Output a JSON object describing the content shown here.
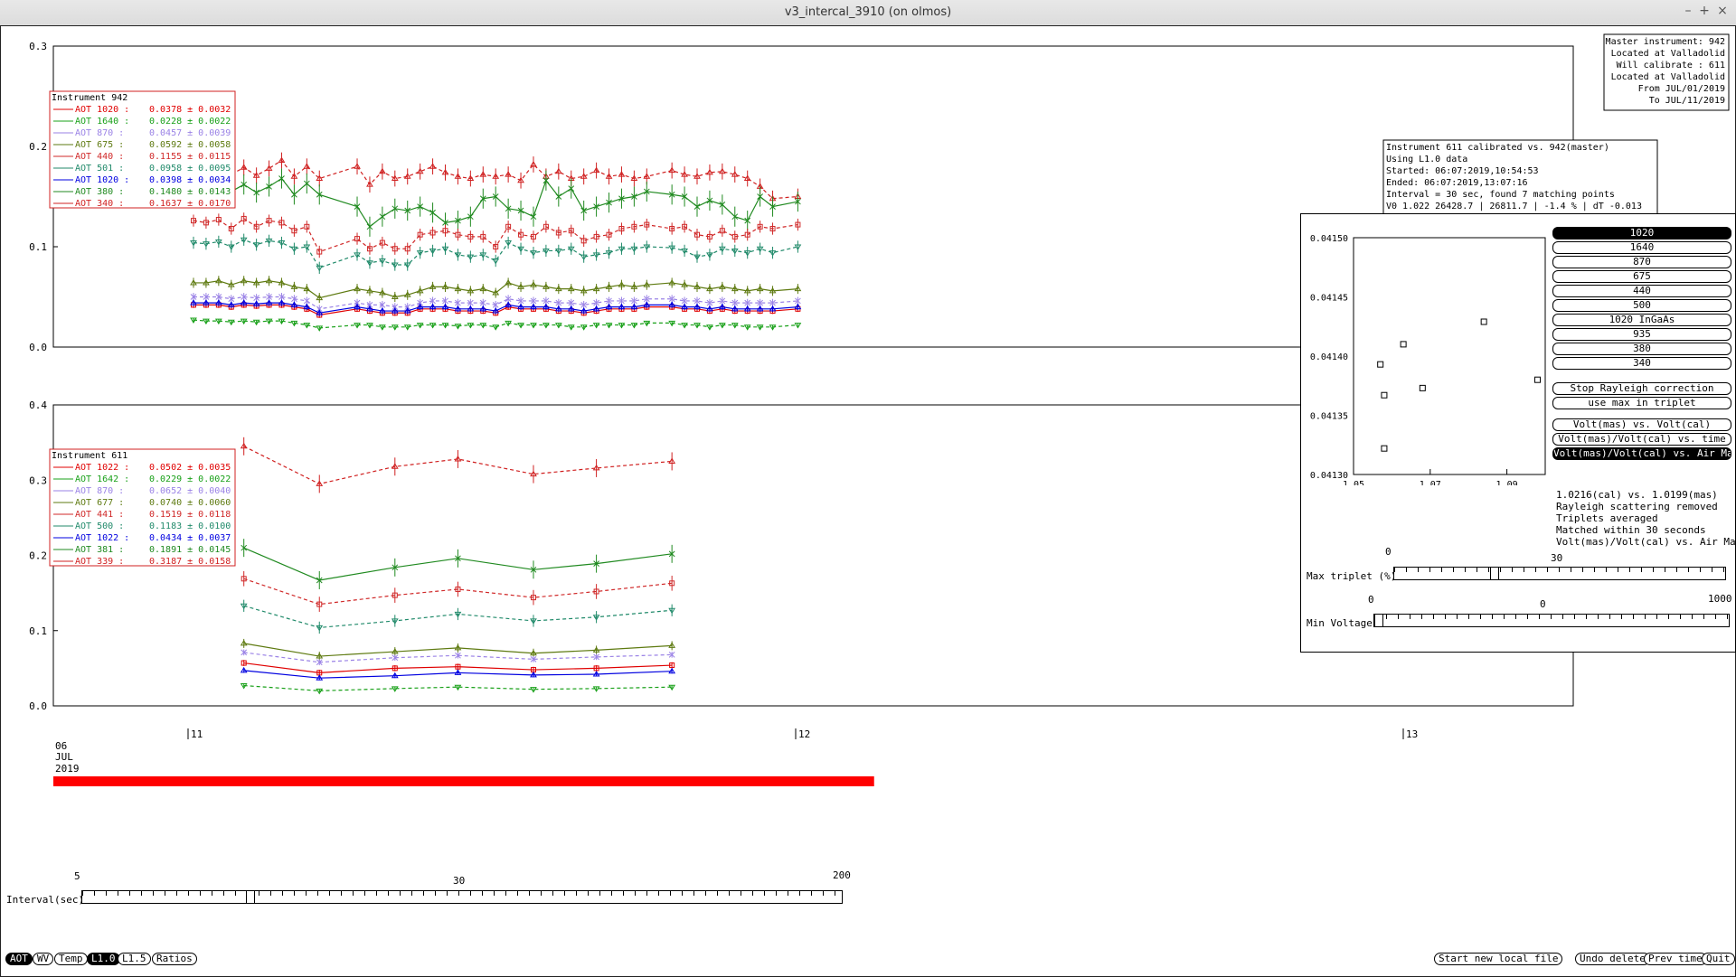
{
  "window": {
    "title": "v3_intercal_3910 (on olmos)"
  },
  "master_info": {
    "lines": [
      "Master instrument: 942",
      "Located at Valladolid",
      "Will calibrate   : 611",
      "Located at Valladolid",
      "From JUL/01/2019",
      "To JUL/11/2019"
    ]
  },
  "cal_info": {
    "lines": [
      "Instrument 611 calibrated vs. 942(master)",
      "Using L1.0 data",
      "Started: 06:07:2019,10:54:53",
      "Ended: 06:07:2019,13:07:16",
      "Interval = 30 sec, found 7 matching points",
      "V0 1.022  26428.7 | 26811.7 | -1.4 % | dT -0.013"
    ]
  },
  "upper_legend": {
    "title": "Instrument 942",
    "items": [
      {
        "label": "AOT 1020 :",
        "value": "0.0378 ± 0.0032",
        "color": "#e00000"
      },
      {
        "label": "AOT 1640 :",
        "value": "0.0228 ± 0.0022",
        "color": "#18a018"
      },
      {
        "label": "AOT 870  :",
        "value": "0.0457 ± 0.0039",
        "color": "#9a82e6"
      },
      {
        "label": "AOT 675  :",
        "value": "0.0592 ± 0.0058",
        "color": "#5e7a10"
      },
      {
        "label": "AOT 440  :",
        "value": "0.1155 ± 0.0115",
        "color": "#d02828"
      },
      {
        "label": "AOT 501  :",
        "value": "0.0958 ± 0.0095",
        "color": "#208a6a"
      },
      {
        "label": "AOT 1020 :",
        "value": "0.0398 ± 0.0034",
        "color": "#0000e0"
      },
      {
        "label": "AOT 380  :",
        "value": "0.1480 ± 0.0143",
        "color": "#208a20"
      },
      {
        "label": "AOT 340  :",
        "value": "0.1637 ± 0.0170",
        "color": "#d02020"
      }
    ]
  },
  "lower_legend": {
    "title": "Instrument 611",
    "items": [
      {
        "label": "AOT 1022 :",
        "value": "0.0502 ± 0.0035",
        "color": "#e00000"
      },
      {
        "label": "AOT 1642 :",
        "value": "0.0229 ± 0.0022",
        "color": "#18a018"
      },
      {
        "label": "AOT 870  :",
        "value": "0.0652 ± 0.0040",
        "color": "#9a82e6"
      },
      {
        "label": "AOT 677  :",
        "value": "0.0740 ± 0.0060",
        "color": "#5e7a10"
      },
      {
        "label": "AOT 441  :",
        "value": "0.1519 ± 0.0118",
        "color": "#d02828"
      },
      {
        "label": "AOT 500  :",
        "value": "0.1183 ± 0.0100",
        "color": "#208a6a"
      },
      {
        "label": "AOT 1022 :",
        "value": "0.0434 ± 0.0037",
        "color": "#0000e0"
      },
      {
        "label": "AOT 381  :",
        "value": "0.1891 ± 0.0145",
        "color": "#208a20"
      },
      {
        "label": "AOT 339  :",
        "value": "0.3187 ± 0.0158",
        "color": "#d02020"
      }
    ]
  },
  "date_label": {
    "line1": "06",
    "line2": "JUL",
    "line3": "2019"
  },
  "chart_data": [
    {
      "type": "line",
      "name": "upper",
      "ylim": [
        0,
        0.3
      ],
      "yticks": [
        "0.0",
        "0.1",
        "0.2",
        "0.3"
      ],
      "x": [
        1,
        1.5,
        2,
        2.5,
        3,
        3.5,
        4,
        4.5,
        5,
        5.5,
        6,
        7.5,
        8,
        8.5,
        9,
        9.5,
        10,
        10.5,
        11,
        11.5,
        12,
        12.5,
        13,
        13.5,
        14,
        14.5,
        15,
        15.5,
        16,
        16.5,
        17,
        17.5,
        18,
        18.5,
        19,
        20,
        20.5,
        21,
        21.5,
        22,
        22.5,
        23,
        23.5,
        24,
        25
      ],
      "series": [
        {
          "color": "#d02020",
          "dash": true,
          "marker": "triangle",
          "values": [
            0.184,
            0.182,
            0.185,
            0.172,
            0.179,
            0.171,
            0.178,
            0.186,
            0.17,
            0.18,
            0.168,
            0.18,
            0.162,
            0.175,
            0.168,
            0.17,
            0.175,
            0.18,
            0.174,
            0.17,
            0.168,
            0.172,
            0.17,
            0.172,
            0.166,
            0.182,
            0.17,
            0.175,
            0.168,
            0.17,
            0.176,
            0.17,
            0.172,
            0.168,
            0.17,
            0.176,
            0.172,
            0.17,
            0.174,
            0.175,
            0.172,
            0.168,
            0.16,
            0.148,
            0.15
          ],
          "err": 0.008
        },
        {
          "color": "#208a20",
          "dash": false,
          "marker": "x",
          "values": [
            0.166,
            0.162,
            0.168,
            0.155,
            0.162,
            0.154,
            0.16,
            0.168,
            0.152,
            0.163,
            0.152,
            0.14,
            0.12,
            0.13,
            0.138,
            0.136,
            0.14,
            0.134,
            0.124,
            0.126,
            0.13,
            0.148,
            0.15,
            0.138,
            0.136,
            0.13,
            0.166,
            0.15,
            0.158,
            0.136,
            0.14,
            0.144,
            0.148,
            0.15,
            0.155,
            0.152,
            0.15,
            0.14,
            0.146,
            0.142,
            0.13,
            0.126,
            0.15,
            0.14,
            0.145
          ],
          "err": 0.01
        },
        {
          "color": "#d02828",
          "dash": true,
          "marker": "square",
          "values": [
            0.126,
            0.124,
            0.127,
            0.118,
            0.128,
            0.12,
            0.126,
            0.124,
            0.116,
            0.12,
            0.095,
            0.108,
            0.098,
            0.104,
            0.098,
            0.098,
            0.112,
            0.114,
            0.116,
            0.112,
            0.11,
            0.11,
            0.1,
            0.12,
            0.112,
            0.11,
            0.12,
            0.114,
            0.116,
            0.106,
            0.11,
            0.112,
            0.118,
            0.12,
            0.122,
            0.118,
            0.12,
            0.112,
            0.11,
            0.116,
            0.11,
            0.112,
            0.12,
            0.118,
            0.122
          ],
          "err": 0.006
        },
        {
          "color": "#208a6a",
          "dash": true,
          "marker": "down",
          "values": [
            0.104,
            0.103,
            0.105,
            0.1,
            0.107,
            0.102,
            0.106,
            0.104,
            0.098,
            0.1,
            0.079,
            0.092,
            0.084,
            0.086,
            0.082,
            0.082,
            0.094,
            0.096,
            0.098,
            0.092,
            0.09,
            0.092,
            0.086,
            0.104,
            0.098,
            0.094,
            0.096,
            0.096,
            0.098,
            0.09,
            0.092,
            0.094,
            0.098,
            0.098,
            0.1,
            0.099,
            0.096,
            0.09,
            0.092,
            0.098,
            0.096,
            0.094,
            0.098,
            0.094,
            0.1
          ],
          "err": 0.006
        },
        {
          "color": "#5e7a10",
          "dash": false,
          "marker": "triangle",
          "values": [
            0.064,
            0.064,
            0.066,
            0.062,
            0.066,
            0.064,
            0.066,
            0.064,
            0.06,
            0.058,
            0.049,
            0.058,
            0.056,
            0.054,
            0.05,
            0.052,
            0.056,
            0.06,
            0.06,
            0.058,
            0.056,
            0.058,
            0.054,
            0.064,
            0.06,
            0.062,
            0.06,
            0.058,
            0.058,
            0.056,
            0.058,
            0.06,
            0.062,
            0.06,
            0.062,
            0.064,
            0.062,
            0.06,
            0.058,
            0.06,
            0.058,
            0.056,
            0.058,
            0.056,
            0.058
          ],
          "err": 0.005
        },
        {
          "color": "#9a82e6",
          "dash": true,
          "marker": "x",
          "values": [
            0.05,
            0.05,
            0.05,
            0.048,
            0.05,
            0.049,
            0.05,
            0.05,
            0.048,
            0.046,
            0.038,
            0.044,
            0.042,
            0.042,
            0.04,
            0.04,
            0.044,
            0.046,
            0.046,
            0.044,
            0.044,
            0.044,
            0.042,
            0.048,
            0.046,
            0.046,
            0.046,
            0.044,
            0.044,
            0.042,
            0.044,
            0.046,
            0.046,
            0.046,
            0.048,
            0.048,
            0.046,
            0.046,
            0.044,
            0.046,
            0.044,
            0.044,
            0.044,
            0.044,
            0.046
          ],
          "err": 0.004
        },
        {
          "color": "#e00000",
          "dash": false,
          "marker": "square",
          "values": [
            0.042,
            0.042,
            0.042,
            0.04,
            0.042,
            0.041,
            0.042,
            0.042,
            0.04,
            0.038,
            0.032,
            0.038,
            0.036,
            0.034,
            0.034,
            0.034,
            0.038,
            0.038,
            0.038,
            0.036,
            0.036,
            0.036,
            0.034,
            0.04,
            0.038,
            0.038,
            0.038,
            0.036,
            0.036,
            0.034,
            0.036,
            0.038,
            0.038,
            0.038,
            0.04,
            0.04,
            0.038,
            0.038,
            0.036,
            0.038,
            0.036,
            0.036,
            0.036,
            0.036,
            0.038
          ],
          "err": 0.003
        },
        {
          "color": "#0000e0",
          "dash": false,
          "marker": "triangle",
          "values": [
            0.044,
            0.044,
            0.044,
            0.042,
            0.044,
            0.043,
            0.044,
            0.044,
            0.042,
            0.04,
            0.034,
            0.04,
            0.038,
            0.036,
            0.036,
            0.036,
            0.04,
            0.04,
            0.04,
            0.038,
            0.038,
            0.038,
            0.036,
            0.042,
            0.04,
            0.04,
            0.04,
            0.038,
            0.038,
            0.036,
            0.038,
            0.04,
            0.04,
            0.04,
            0.042,
            0.042,
            0.04,
            0.04,
            0.038,
            0.04,
            0.038,
            0.038,
            0.038,
            0.038,
            0.04
          ],
          "err": 0.003
        },
        {
          "color": "#18a018",
          "dash": true,
          "marker": "down",
          "values": [
            0.027,
            0.026,
            0.026,
            0.025,
            0.026,
            0.025,
            0.026,
            0.026,
            0.024,
            0.022,
            0.019,
            0.022,
            0.022,
            0.02,
            0.02,
            0.02,
            0.022,
            0.022,
            0.022,
            0.021,
            0.022,
            0.022,
            0.02,
            0.024,
            0.022,
            0.022,
            0.022,
            0.022,
            0.02,
            0.02,
            0.022,
            0.022,
            0.022,
            0.022,
            0.024,
            0.024,
            0.022,
            0.022,
            0.02,
            0.022,
            0.022,
            0.02,
            0.02,
            0.02,
            0.022
          ],
          "err": 0.002
        }
      ]
    },
    {
      "type": "line",
      "name": "lower",
      "ylim": [
        0,
        0.4
      ],
      "yticks": [
        "0.0",
        "0.1",
        "0.2",
        "0.3",
        "0.4"
      ],
      "x": [
        3,
        6,
        9,
        11.5,
        14.5,
        17,
        20
      ],
      "series": [
        {
          "color": "#d02020",
          "dash": true,
          "marker": "triangle",
          "values": [
            0.345,
            0.295,
            0.318,
            0.328,
            0.308,
            0.316,
            0.325
          ],
          "err": 0.012
        },
        {
          "color": "#208a20",
          "dash": false,
          "marker": "x",
          "values": [
            0.21,
            0.167,
            0.184,
            0.196,
            0.181,
            0.189,
            0.202
          ],
          "err": 0.012
        },
        {
          "color": "#d02828",
          "dash": true,
          "marker": "square",
          "values": [
            0.169,
            0.135,
            0.147,
            0.155,
            0.144,
            0.152,
            0.163
          ],
          "err": 0.01
        },
        {
          "color": "#208a6a",
          "dash": true,
          "marker": "down",
          "values": [
            0.133,
            0.104,
            0.113,
            0.122,
            0.113,
            0.118,
            0.127
          ],
          "err": 0.008
        },
        {
          "color": "#5e7a10",
          "dash": false,
          "marker": "triangle",
          "values": [
            0.083,
            0.066,
            0.072,
            0.077,
            0.07,
            0.074,
            0.08
          ],
          "err": 0.006
        },
        {
          "color": "#9a82e6",
          "dash": true,
          "marker": "x",
          "values": [
            0.071,
            0.058,
            0.064,
            0.067,
            0.062,
            0.065,
            0.068
          ],
          "err": 0.004
        },
        {
          "color": "#e00000",
          "dash": false,
          "marker": "square",
          "values": [
            0.057,
            0.044,
            0.05,
            0.052,
            0.048,
            0.05,
            0.054
          ],
          "err": 0.004
        },
        {
          "color": "#0000e0",
          "dash": false,
          "marker": "triangle",
          "values": [
            0.047,
            0.037,
            0.04,
            0.044,
            0.041,
            0.042,
            0.046
          ],
          "err": 0.003
        },
        {
          "color": "#18a018",
          "dash": true,
          "marker": "down",
          "values": [
            0.027,
            0.02,
            0.023,
            0.025,
            0.022,
            0.023,
            0.025
          ],
          "err": 0.002
        }
      ]
    },
    {
      "type": "scatter",
      "name": "airmass",
      "xlim": [
        1.05,
        1.1
      ],
      "ylim": [
        0.0413,
        0.0415
      ],
      "yticks": [
        "0.04150",
        "0.04145",
        "0.04140",
        "0.04135",
        "0.04130"
      ],
      "xticks": [
        "1.05",
        "1.07",
        "1.09"
      ],
      "points": [
        [
          1.057,
          0.041393
        ],
        [
          1.058,
          0.041367
        ],
        [
          1.058,
          0.041322
        ],
        [
          1.063,
          0.04141
        ],
        [
          1.068,
          0.041373
        ],
        [
          1.084,
          0.041429
        ],
        [
          1.098,
          0.04138
        ]
      ]
    }
  ],
  "time_axis": {
    "ticks": [
      "11",
      "12",
      "13"
    ]
  },
  "channels": [
    "1020",
    "1640",
    "870",
    "675",
    "440",
    "500",
    "1020 InGaAs",
    "935",
    "380",
    "340"
  ],
  "selected_channel": 0,
  "options": [
    "Stop Rayleigh correction",
    "use max in triplet"
  ],
  "plot_modes": [
    "Volt(mas) vs. Volt(cal)",
    "Volt(mas)/Volt(cal) vs. time",
    "Volt(mas)/Volt(cal) vs. Air Mass"
  ],
  "selected_mode": 2,
  "overlay_info": {
    "lines": [
      "1.0216(cal) vs. 1.0199(mas)",
      "Rayleigh scattering removed",
      "Triplets averaged",
      "Matched within 30 seconds",
      "Volt(mas)/Volt(cal) vs. Air Mass"
    ]
  },
  "max_triplet": {
    "label": "Max triplet (%)",
    "min": "0",
    "mid": "30",
    "level": 30
  },
  "min_voltage": {
    "label": "Min Voltage",
    "min": "0",
    "mid": "0",
    "max": "1000",
    "level": 0
  },
  "interval_slider": {
    "label": "Interval(sec)",
    "min": "5",
    "mid": "30",
    "max": "200",
    "value": 30
  },
  "progress": {
    "color": "#ff0000",
    "fraction": 0.54
  },
  "mode_buttons": [
    "AOT",
    "WV",
    "Temp",
    "L1.0",
    "L1.5",
    "Ratios"
  ],
  "selected_modes": [
    0,
    3
  ],
  "actions": [
    "Start new local file",
    "Undo delete",
    "Prev time",
    "Quit"
  ]
}
